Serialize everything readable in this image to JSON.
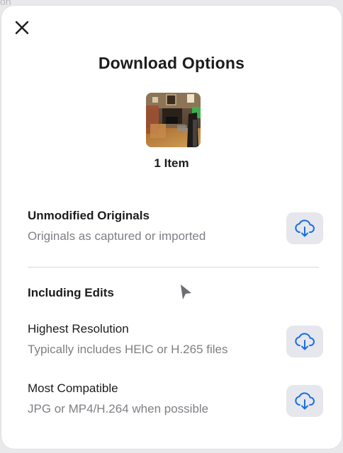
{
  "background": {
    "peek_text": "on"
  },
  "dialog": {
    "title": "Download Options",
    "item_count": "1 Item",
    "options": [
      {
        "title": "Unmodified Originals",
        "subtitle": "Originals as captured or imported"
      }
    ],
    "section": {
      "heading": "Including Edits",
      "options": [
        {
          "title": "Highest Resolution",
          "subtitle": "Typically includes HEIC or H.265 files"
        },
        {
          "title": "Most Compatible",
          "subtitle": "JPG or MP4/H.264 when possible"
        }
      ]
    }
  },
  "icons": {
    "close": "close-icon",
    "download": "cloud-download-icon",
    "cursor": "pointer-cursor-icon"
  },
  "colors": {
    "accent": "#1a6fe6",
    "button_bg": "#e6e7ec",
    "text_primary": "#1c1c1e",
    "text_secondary": "#7f7f85"
  }
}
